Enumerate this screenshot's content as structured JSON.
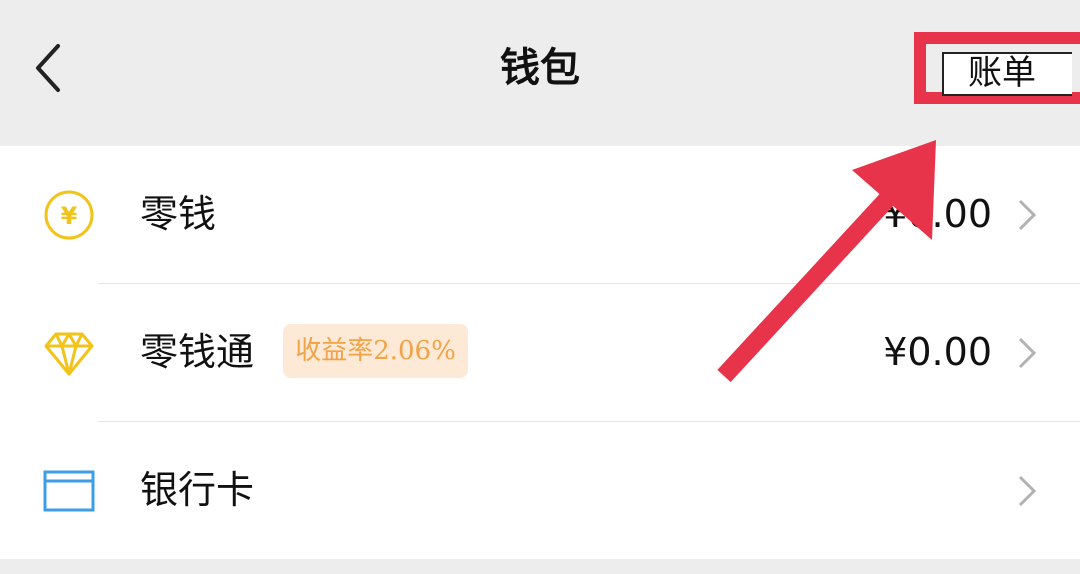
{
  "header": {
    "title": "钱包",
    "bill_label": "账单"
  },
  "rows": [
    {
      "label": "零钱",
      "amount": "¥0.00",
      "icon": "yuan-coin-icon"
    },
    {
      "label": "零钱通",
      "badge": "收益率2.06%",
      "amount": "¥0.00",
      "icon": "diamond-icon"
    },
    {
      "label": "银行卡",
      "icon": "bank-card-icon"
    }
  ],
  "colors": {
    "highlight": "#e8344a",
    "coin": "#f2c318",
    "card": "#3d9ee6",
    "badge_text": "#f0a347",
    "badge_bg": "#fde9d6"
  }
}
